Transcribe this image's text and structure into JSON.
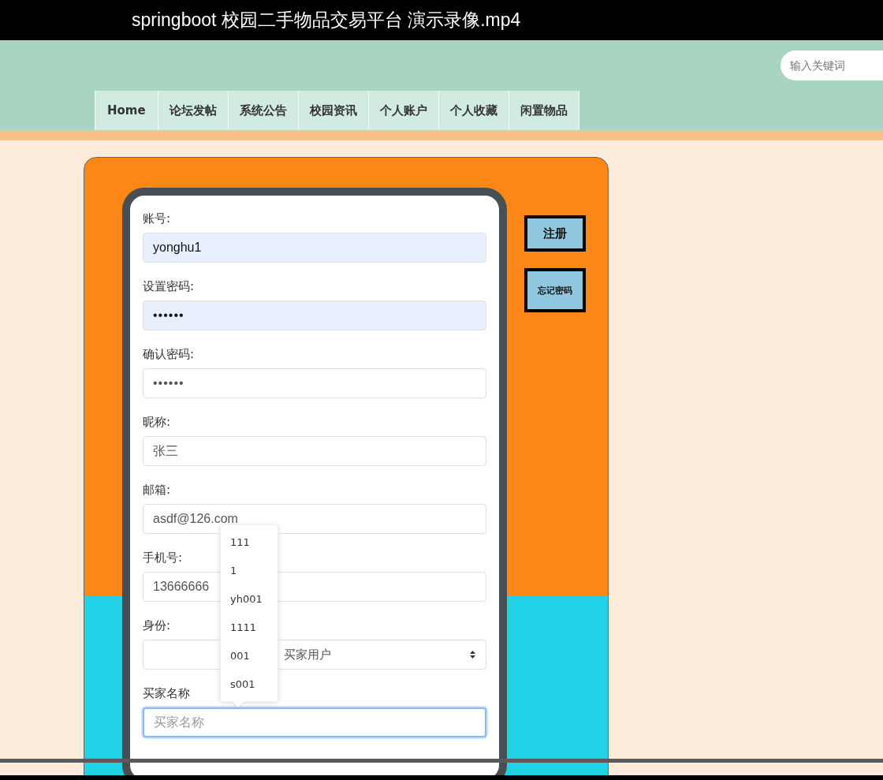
{
  "video_title": "springboot 校园二手物品交易平台 演示录像.mp4",
  "search": {
    "placeholder": "输入关键词"
  },
  "nav": [
    {
      "label": "Home",
      "selected": false
    },
    {
      "label": "论坛发帖",
      "selected": false
    },
    {
      "label": "系统公告",
      "selected": false
    },
    {
      "label": "校园资讯",
      "selected": false
    },
    {
      "label": "个人账户",
      "selected": false
    },
    {
      "label": "个人收藏",
      "selected": false
    },
    {
      "label": "闲置物品",
      "selected": false
    }
  ],
  "form": {
    "fields": [
      {
        "kind": "text",
        "label": "账号:",
        "value": "yonghu1",
        "autofilled": true,
        "focused": false
      },
      {
        "kind": "password",
        "label": "设置密码:",
        "value": "••••••",
        "autofilled": true,
        "focused": false
      },
      {
        "kind": "password",
        "label": "确认密码:",
        "value": "••••••",
        "autofilled": false,
        "focused": false
      },
      {
        "kind": "text",
        "label": "昵称:",
        "value": "张三",
        "autofilled": false,
        "focused": false
      },
      {
        "kind": "text",
        "label": "邮箱:",
        "value": "asdf@126.com",
        "autofilled": false,
        "focused": false
      },
      {
        "kind": "text",
        "label": "手机号:",
        "value": "13666666",
        "autofilled": false,
        "focused": false
      },
      {
        "kind": "select",
        "label": "身份:",
        "value": "买家用户"
      },
      {
        "kind": "text",
        "label": "买家名称",
        "placeholder": "买家名称",
        "autofilled": false,
        "focused": true
      }
    ]
  },
  "buttons": [
    "注册",
    "忘记密码"
  ],
  "suggestions": [
    "111",
    "1",
    "yh001",
    "1111",
    "001",
    "s001"
  ],
  "video": {
    "level": 1
  }
}
